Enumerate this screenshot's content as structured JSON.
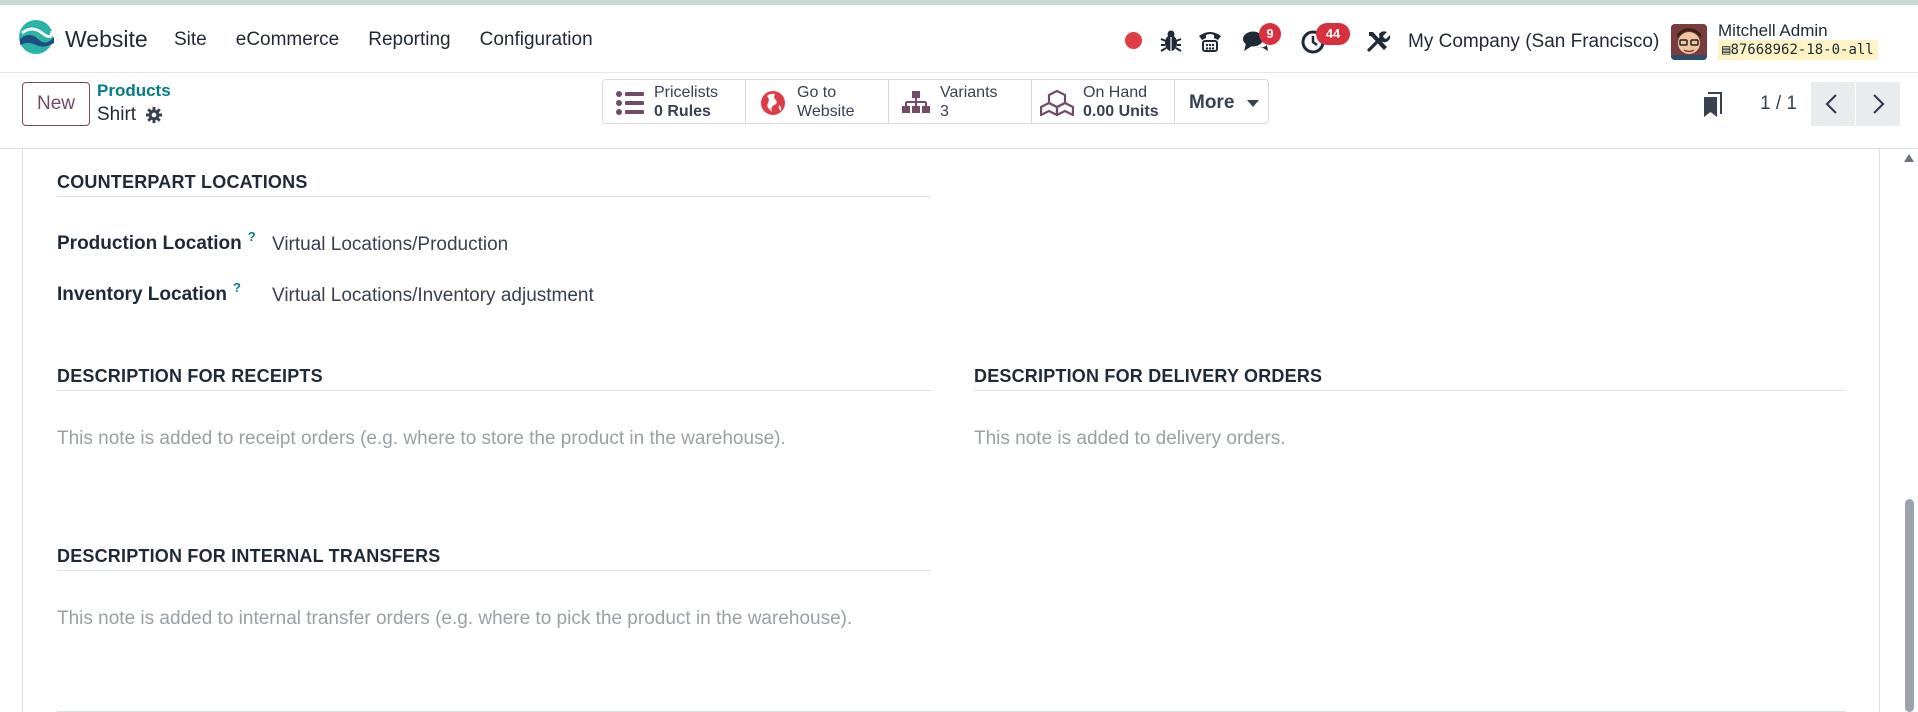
{
  "navbar": {
    "app_name": "Website",
    "menu": [
      "Site",
      "eCommerce",
      "Reporting",
      "Configuration"
    ],
    "messages_count": "9",
    "activities_count": "44",
    "company": "My Company (San Francisco)",
    "user_name": "Mitchell Admin",
    "database": "87668962-18-0-all"
  },
  "control": {
    "new_label": "New",
    "breadcrumb_parent": "Products",
    "breadcrumb_current": "Shirt",
    "smart_buttons": [
      {
        "label": "Pricelists",
        "value_num": "0",
        "value_unit": "Rules"
      },
      {
        "label": "Go to",
        "value": "Website"
      },
      {
        "label": "Variants",
        "value": "3"
      },
      {
        "label": "On Hand",
        "value_num": "0.00",
        "value_unit": "Units"
      }
    ],
    "more_label": "More",
    "pager": "1 / 1"
  },
  "form": {
    "counterpart": {
      "title": "COUNTERPART LOCATIONS",
      "production_label": "Production Location",
      "production_value": "Virtual Locations/Production",
      "inventory_label": "Inventory Location",
      "inventory_value": "Virtual Locations/Inventory adjustment",
      "help": "?"
    },
    "receipts": {
      "title": "DESCRIPTION FOR RECEIPTS",
      "placeholder": "This note is added to receipt orders (e.g. where to store the product in the warehouse)."
    },
    "delivery": {
      "title": "DESCRIPTION FOR DELIVERY ORDERS",
      "placeholder": "This note is added to delivery orders."
    },
    "internal": {
      "title": "DESCRIPTION FOR INTERNAL TRANSFERS",
      "placeholder": "This note is added to internal transfer orders (e.g. where to pick the product in the warehouse)."
    }
  },
  "colors": {
    "brand": "#714b67",
    "link": "#017e84",
    "badge": "#d9303e"
  }
}
